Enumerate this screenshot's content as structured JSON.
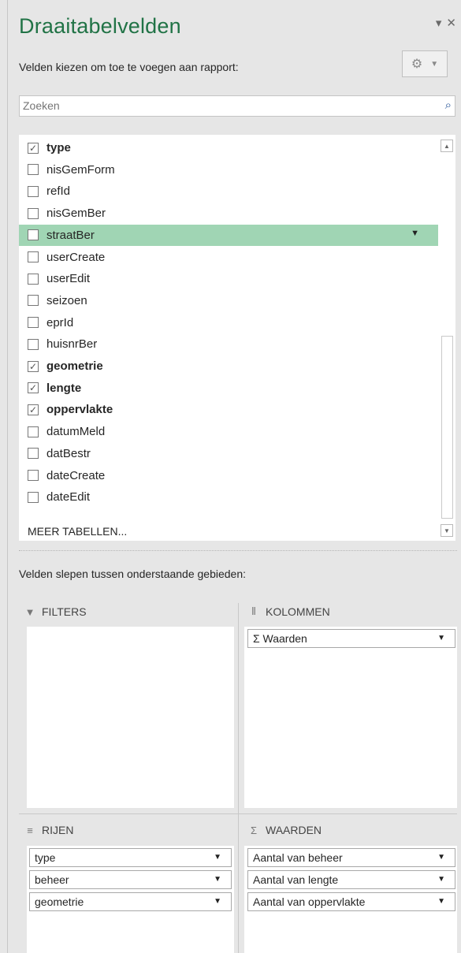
{
  "panel": {
    "title": "Draaitabelvelden",
    "choose_label": "Velden kiezen om toe te voegen aan rapport:",
    "search_placeholder": "Zoeken"
  },
  "fields": [
    {
      "name": "type",
      "checked": true
    },
    {
      "name": "nisGemForm",
      "checked": false
    },
    {
      "name": "refId",
      "checked": false
    },
    {
      "name": "nisGemBer",
      "checked": false
    },
    {
      "name": "straatBer",
      "checked": false,
      "selected": true
    },
    {
      "name": "userCreate",
      "checked": false
    },
    {
      "name": "userEdit",
      "checked": false
    },
    {
      "name": "seizoen",
      "checked": false
    },
    {
      "name": "eprId",
      "checked": false
    },
    {
      "name": "huisnrBer",
      "checked": false
    },
    {
      "name": "geometrie",
      "checked": true
    },
    {
      "name": "lengte",
      "checked": true
    },
    {
      "name": "oppervlakte",
      "checked": true
    },
    {
      "name": "datumMeld",
      "checked": false
    },
    {
      "name": "datBestr",
      "checked": false
    },
    {
      "name": "dateCreate",
      "checked": false
    },
    {
      "name": "dateEdit",
      "checked": false
    }
  ],
  "more_tables": "MEER TABELLEN...",
  "drag_label": "Velden slepen tussen onderstaande gebieden:",
  "areas": {
    "filters": {
      "label": "FILTERS",
      "items": []
    },
    "columns": {
      "label": "KOLOMMEN",
      "items": [
        "Σ Waarden"
      ]
    },
    "rows": {
      "label": "RIJEN",
      "items": [
        "type",
        "beheer",
        "geometrie"
      ]
    },
    "values": {
      "label": "WAARDEN",
      "items": [
        "Aantal van beheer",
        "Aantal van lengte",
        "Aantal van oppervlakte"
      ]
    }
  },
  "icons": {
    "filter": "funnel-icon",
    "columns": "columns-icon",
    "rows": "rows-icon",
    "values": "sigma-icon"
  },
  "colors": {
    "title": "#217346",
    "selected_row": "#a0d5b4"
  }
}
